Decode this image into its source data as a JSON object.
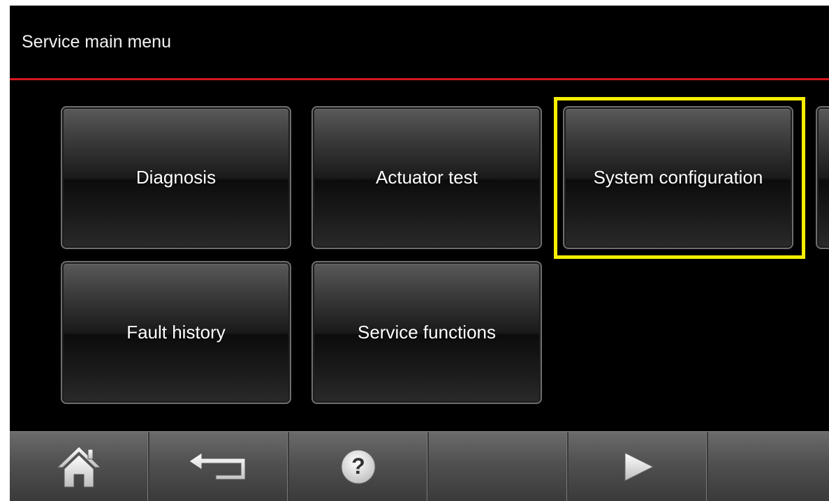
{
  "header": {
    "title": "Service main menu"
  },
  "menu": {
    "tiles": [
      {
        "label": "Diagnosis"
      },
      {
        "label": "Actuator test"
      },
      {
        "label": "System configuration",
        "highlighted": true
      },
      {
        "label": "Fault history"
      },
      {
        "label": "Service functions"
      }
    ]
  },
  "toolbar": {
    "buttons": [
      {
        "icon": "home-icon"
      },
      {
        "icon": "back-arrow-icon"
      },
      {
        "icon": "help-icon"
      },
      {
        "icon": ""
      },
      {
        "icon": "play-next-icon"
      },
      {
        "icon": ""
      }
    ]
  },
  "colors": {
    "accent_line": "#d4181e",
    "highlight_box": "#f5ef00",
    "background": "#000000"
  }
}
